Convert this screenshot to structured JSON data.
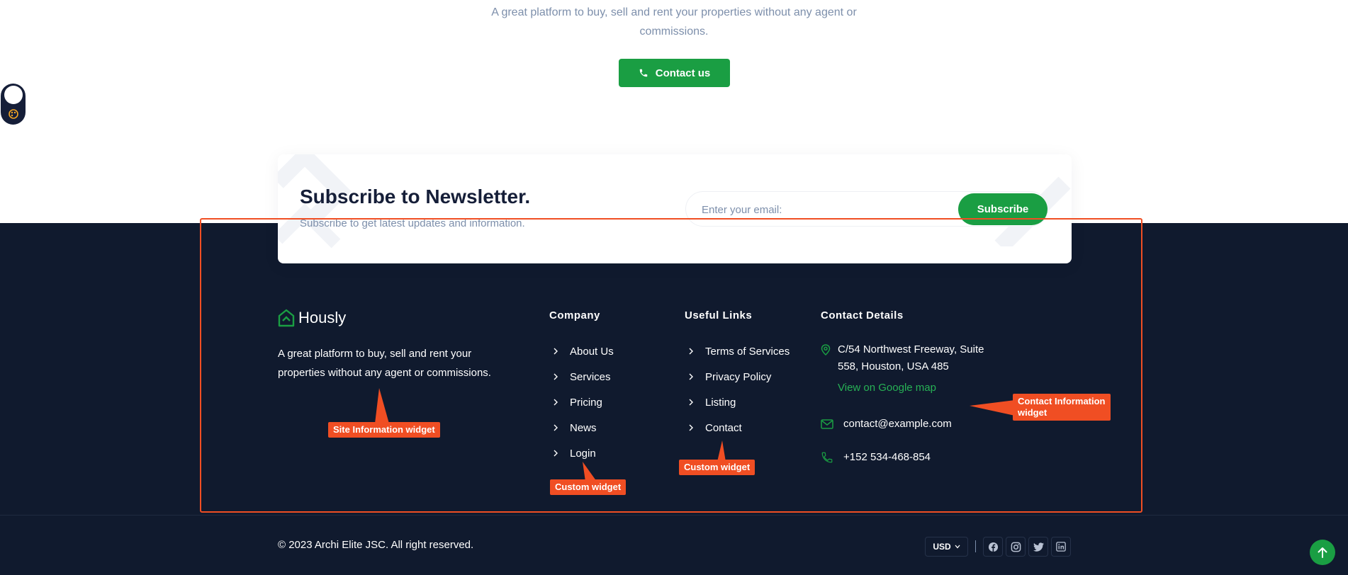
{
  "hero": {
    "description_line1": "A great platform to buy, sell and rent your properties without any agent or",
    "description_line2": "commissions.",
    "contact_label": "Contact us"
  },
  "newsletter": {
    "title": "Subscribe to Newsletter.",
    "subtitle": "Subscribe to get latest updates and information.",
    "email_placeholder": "Enter your email:",
    "subscribe_label": "Subscribe"
  },
  "footer": {
    "brand_name": "Hously",
    "site_description": "A great platform to buy, sell and rent your properties without any agent or commissions.",
    "company": {
      "title": "Company",
      "links": [
        "About Us",
        "Services",
        "Pricing",
        "News",
        "Login"
      ]
    },
    "useful_links": {
      "title": "Useful Links",
      "links": [
        "Terms of Services",
        "Privacy Policy",
        "Listing",
        "Contact"
      ]
    },
    "contact": {
      "title": "Contact Details",
      "address_line1": "C/54 Northwest Freeway, Suite",
      "address_line2": "558, Houston, USA 485",
      "map_link": "View on Google map",
      "email": "contact@example.com",
      "phone": "+152 534-468-854"
    },
    "copyright": "© 2023 Archi Elite JSC. All right reserved.",
    "currency": "USD",
    "social_icons": [
      "facebook-icon",
      "instagram-icon",
      "twitter-icon",
      "linkedin-icon"
    ]
  },
  "annotations": {
    "site_info": "Site Information widget",
    "custom_1": "Custom widget",
    "custom_2": "Custom widget",
    "contact_info_line1": "Contact Information",
    "contact_info_line2": "widget"
  },
  "colors": {
    "accent": "#1a9e43",
    "footer_bg": "#101a2e",
    "annotation": "#f04e23",
    "muted_text": "#7d8fab"
  }
}
